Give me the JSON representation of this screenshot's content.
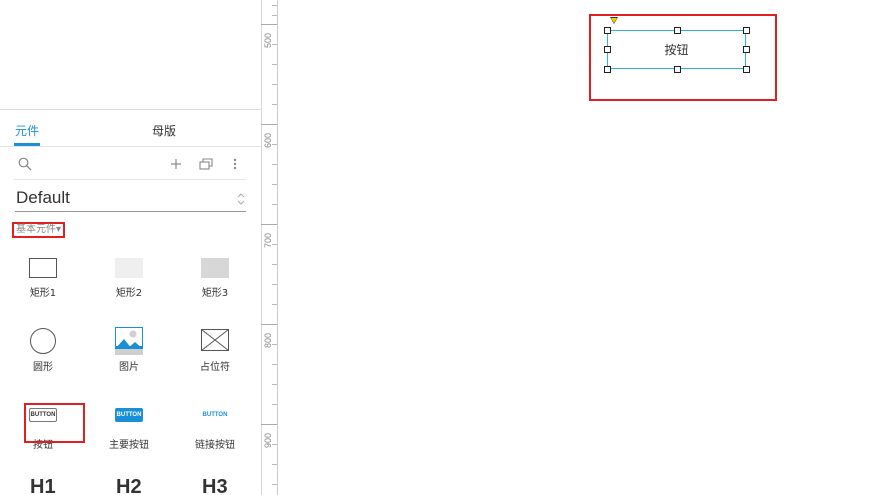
{
  "panel": {
    "tabs": [
      {
        "label": "元件",
        "active": true
      },
      {
        "label": "母版",
        "active": false
      }
    ],
    "library": "Default",
    "section": "基本元件",
    "section_arrow": "▾",
    "widgets": [
      {
        "label": "矩形1"
      },
      {
        "label": "矩形2"
      },
      {
        "label": "矩形3"
      },
      {
        "label": "圆形"
      },
      {
        "label": "图片"
      },
      {
        "label": "占位符"
      },
      {
        "label": "按钮",
        "thumb_text": "BUTTON"
      },
      {
        "label": "主要按钮",
        "thumb_text": "BUTTON"
      },
      {
        "label": "链接按钮",
        "thumb_text": "BUTTON"
      }
    ],
    "headings": [
      "H1",
      "H2",
      "H3"
    ]
  },
  "ruler": {
    "labels": [
      "500",
      "600",
      "700",
      "800",
      "900"
    ]
  },
  "canvas": {
    "button_label": "按钮"
  },
  "colors": {
    "accent": "#1a8fd8",
    "highlight": "#e02020",
    "selection": "#2bb7c9"
  },
  "icons": [
    "search-icon",
    "plus-icon",
    "copy-icon",
    "more-vertical-icon",
    "chevron-updown-icon",
    "image-icon",
    "placeholder-icon"
  ]
}
